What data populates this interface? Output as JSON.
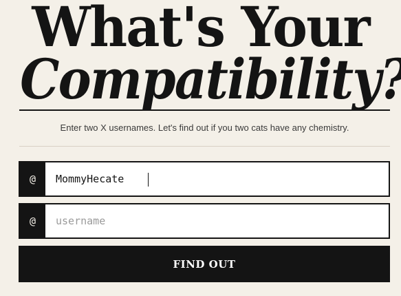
{
  "header": {
    "title_line1": "What's Your",
    "title_line2": "Compatibility?"
  },
  "intro": {
    "subtitle": "Enter two X usernames. Let's find out if you two cats have any chemistry."
  },
  "form": {
    "prefix_symbol": "@",
    "username1": {
      "value": "MommyHecate",
      "placeholder": "username"
    },
    "username2": {
      "value": "",
      "placeholder": "username"
    },
    "submit_label": "FIND OUT"
  },
  "colors": {
    "background": "#f4f0e8",
    "ink": "#141414",
    "divider": "#d8d0c5",
    "placeholder": "#9a9a9a"
  }
}
